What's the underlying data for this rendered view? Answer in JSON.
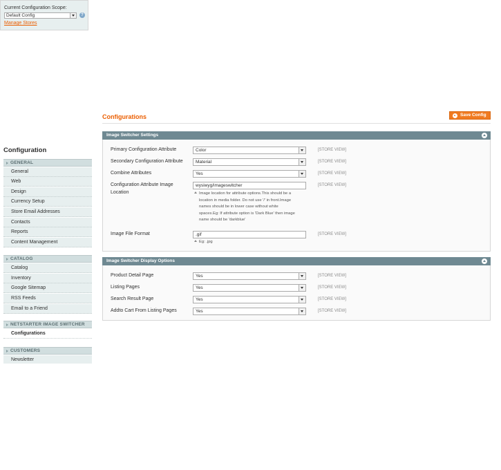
{
  "scope": {
    "label": "Current Configuration Scope:",
    "selected": "Default Config",
    "manage_link": "Manage Stores"
  },
  "sidebar": {
    "title": "Configuration",
    "sections": [
      {
        "label": "GENERAL",
        "items": [
          "General",
          "Web",
          "Design",
          "Currency Setup",
          "Store Email Addresses",
          "Contacts",
          "Reports",
          "Content Management"
        ]
      },
      {
        "label": "CATALOG",
        "items": [
          "Catalog",
          "Inventory",
          "Google Sitemap",
          "RSS Feeds",
          "Email to a Friend"
        ]
      },
      {
        "label": "NETSTARTER IMAGE SWITCHER",
        "items": [
          "Configurations"
        ]
      },
      {
        "label": "CUSTOMERS",
        "items": [
          "Newsletter"
        ]
      }
    ]
  },
  "header": {
    "title": "Configurations",
    "save_label": "Save Config"
  },
  "image_switcher_settings": {
    "title": "Image Switcher Settings",
    "rows": [
      {
        "label": "Primary Configuration Attribute",
        "value": "Color",
        "scope": "[STORE VIEW]"
      },
      {
        "label": "Secondary Configuration Attribute",
        "value": "Material",
        "scope": "[STORE VIEW]"
      },
      {
        "label": "Combine Attributes",
        "value": "Yes",
        "scope": "[STORE VIEW]"
      },
      {
        "label_line1": "Configuration Attribute Image",
        "label_line2": "Location",
        "value": "wysiwyg/imageswitcher",
        "scope": "[STORE VIEW]",
        "note": [
          "Image location for attribute options.This should be a",
          "location in media folder. Do not use '/' in front.Image",
          "names should be in lower case without white",
          "spaces.Eg: If attribute option is 'Dark Blue' then image",
          "name should be 'darkblue'"
        ]
      },
      {
        "label": "Image File Format",
        "value": ".gif",
        "scope": "[STORE VIEW]",
        "note": "Eg: .jpg"
      }
    ]
  },
  "display_options": {
    "title": "Image Switcher Display Options",
    "rows": [
      {
        "label": "Product Detail Page",
        "value": "Yes",
        "scope": "[STORE VIEW]"
      },
      {
        "label": "Listing Pages",
        "value": "Yes",
        "scope": "[STORE VIEW]"
      },
      {
        "label": "Search Result Page",
        "value": "Yes",
        "scope": "[STORE VIEW]"
      },
      {
        "label": "Addto Cart From Listing Pages",
        "value": "Yes",
        "scope": "[STORE VIEW]"
      }
    ]
  },
  "icons": {
    "help": "help-icon",
    "save": "save-icon",
    "collapse": "collapse-icon",
    "dropdown": "chevron-down-icon"
  },
  "colors": {
    "accent": "#eb5e00",
    "section_header": "#6f8992",
    "sidebar_bg": "#e7efef",
    "sidebar_section": "#d1dedf",
    "save_button": "#f07b21"
  }
}
